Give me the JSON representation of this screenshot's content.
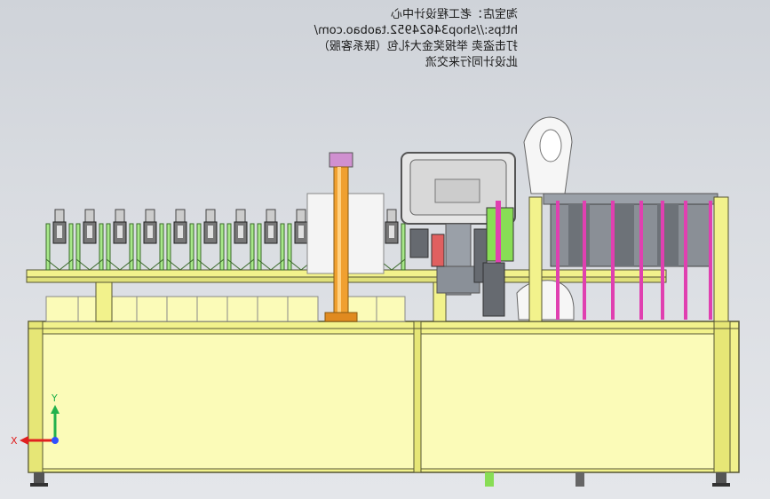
{
  "watermark": {
    "line1": "淘宝店：老工程设计中心",
    "line2": "https://shop34624952.taobao.com/",
    "line3": "打击盗卖 举报奖金大礼包（联系客服）",
    "line4": "此设计同行来交流"
  },
  "axes": {
    "y_label": "Y",
    "x_label": "X",
    "colors": {
      "y": "#22b14c",
      "x": "#e02020",
      "z": "#3050ff"
    }
  },
  "colors": {
    "frame": "#f2f28c",
    "frame_edge": "#555533",
    "post_green": "#a8e88a",
    "orange_column": "#f0a030",
    "magenta": "#e040b0",
    "dark_gray": "#666a70"
  }
}
